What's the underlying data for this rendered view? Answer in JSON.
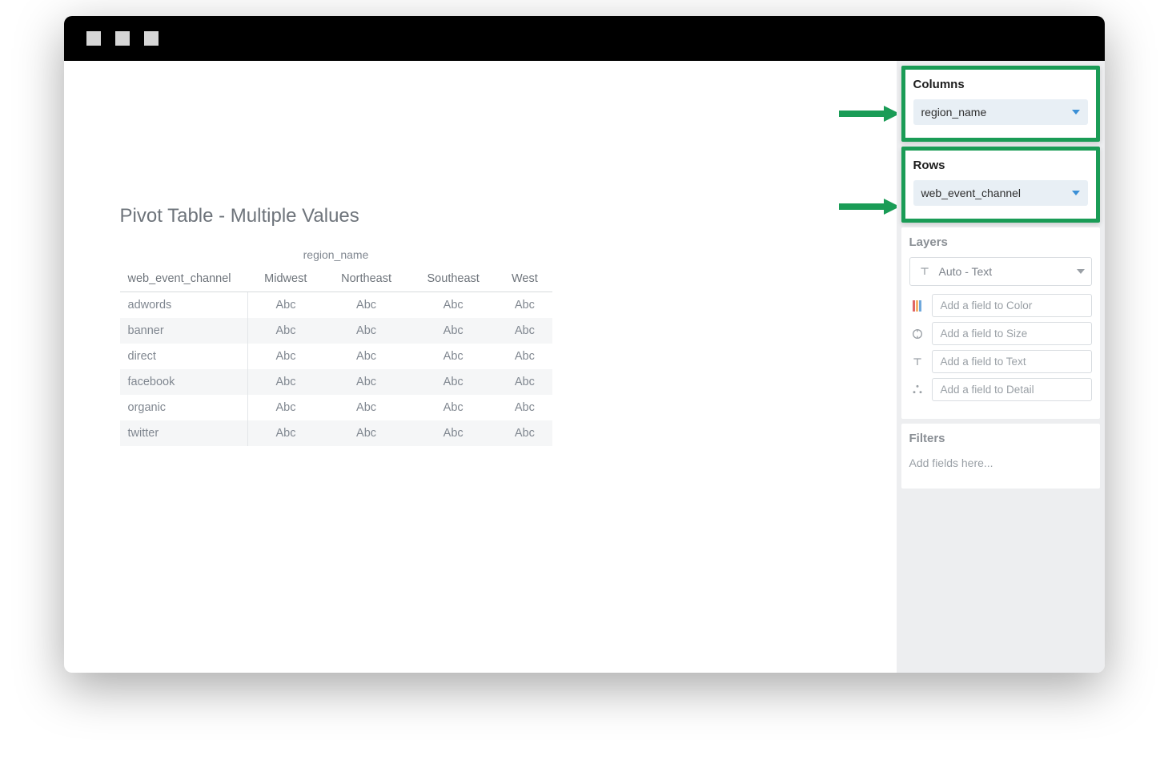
{
  "chart_title": "Pivot Table - Multiple Values",
  "columns_header_field": "region_name",
  "row_header_field": "web_event_channel",
  "columns": [
    "Midwest",
    "Northeast",
    "Southeast",
    "West"
  ],
  "rows": [
    "adwords",
    "banner",
    "direct",
    "facebook",
    "organic",
    "twitter"
  ],
  "cell_placeholder": "Abc",
  "side": {
    "columns_label": "Columns",
    "columns_pill": "region_name",
    "rows_label": "Rows",
    "rows_pill": "web_event_channel",
    "layers_label": "Layers",
    "layers_select": "Auto - Text",
    "color_ph": "Add a field to Color",
    "size_ph": "Add a field to Size",
    "text_ph": "Add a field to Text",
    "detail_ph": "Add a field to Detail",
    "filters_label": "Filters",
    "filters_ph": "Add fields here..."
  },
  "chart_data": {
    "type": "table",
    "title": "Pivot Table - Multiple Values",
    "column_dimension": "region_name",
    "row_dimension": "web_event_channel",
    "columns": [
      "Midwest",
      "Northeast",
      "Southeast",
      "West"
    ],
    "rows": [
      "adwords",
      "banner",
      "direct",
      "facebook",
      "organic",
      "twitter"
    ],
    "values": [
      [
        "Abc",
        "Abc",
        "Abc",
        "Abc"
      ],
      [
        "Abc",
        "Abc",
        "Abc",
        "Abc"
      ],
      [
        "Abc",
        "Abc",
        "Abc",
        "Abc"
      ],
      [
        "Abc",
        "Abc",
        "Abc",
        "Abc"
      ],
      [
        "Abc",
        "Abc",
        "Abc",
        "Abc"
      ],
      [
        "Abc",
        "Abc",
        "Abc",
        "Abc"
      ]
    ]
  }
}
